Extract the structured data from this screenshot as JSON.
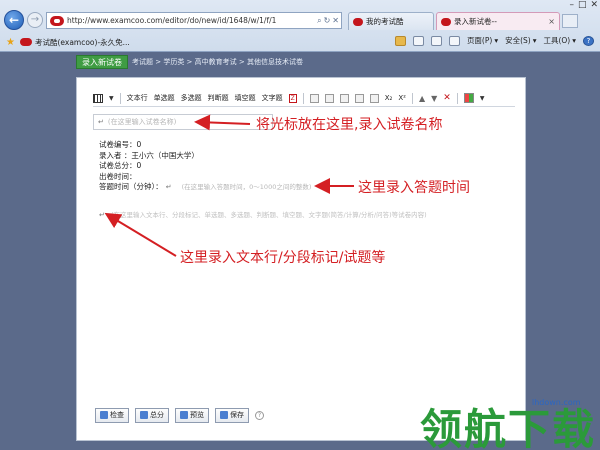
{
  "browser": {
    "url": "http://www.examcoo.com/editor/do/new/id/1648/w/1/f/1",
    "tabs": [
      {
        "label": "我的考试酷"
      },
      {
        "label": "录入新试卷--"
      }
    ],
    "favorite_title": "考试酷(examcoo)-永久免...",
    "tools": {
      "page": "页面(P)",
      "safety": "安全(S)",
      "tools": "工具(O)"
    }
  },
  "page_bar": {
    "new_button": "录入新试卷",
    "breadcrumb": "考试题 > 学历类 > 高中教育考试 > 其他信息技术试卷"
  },
  "editor_toolbar": {
    "items": [
      "文本行",
      "单选题",
      "多选题",
      "判断题",
      "填空题",
      "文字题"
    ]
  },
  "editor": {
    "name_placeholder": "(在这里输入试卷名称)",
    "info_lines": [
      "试卷编号：0",
      "录入者 ：王小六（中国大学）",
      "试卷总分：0",
      "出卷时间：",
      "答题时间（分钟）："
    ],
    "time_placeholder": "(在这里输入答题时间，0～1000之间的整数)",
    "body_placeholder": "(在这里输入文本行、分段标记、单选题、多选题、判断题、填空题、文字题(简答/计算/分析/问答)等试卷内容)"
  },
  "bottom_buttons": {
    "check": "检查",
    "score": "总分",
    "preview": "预览",
    "save": "保存"
  },
  "annotations": {
    "a1": "将光标放在这里,录入试卷名称",
    "a2": "这里录入答题时间",
    "a3": "这里录入文本行/分段标记/试题等"
  },
  "watermark": {
    "url": "lhdown.com",
    "logo": "领航下载"
  },
  "colors": {
    "background": "#5b6a8a",
    "annotation_red": "#d41f23",
    "green_button": "#3f9c43",
    "watermark_green": "#2b9a3a"
  }
}
